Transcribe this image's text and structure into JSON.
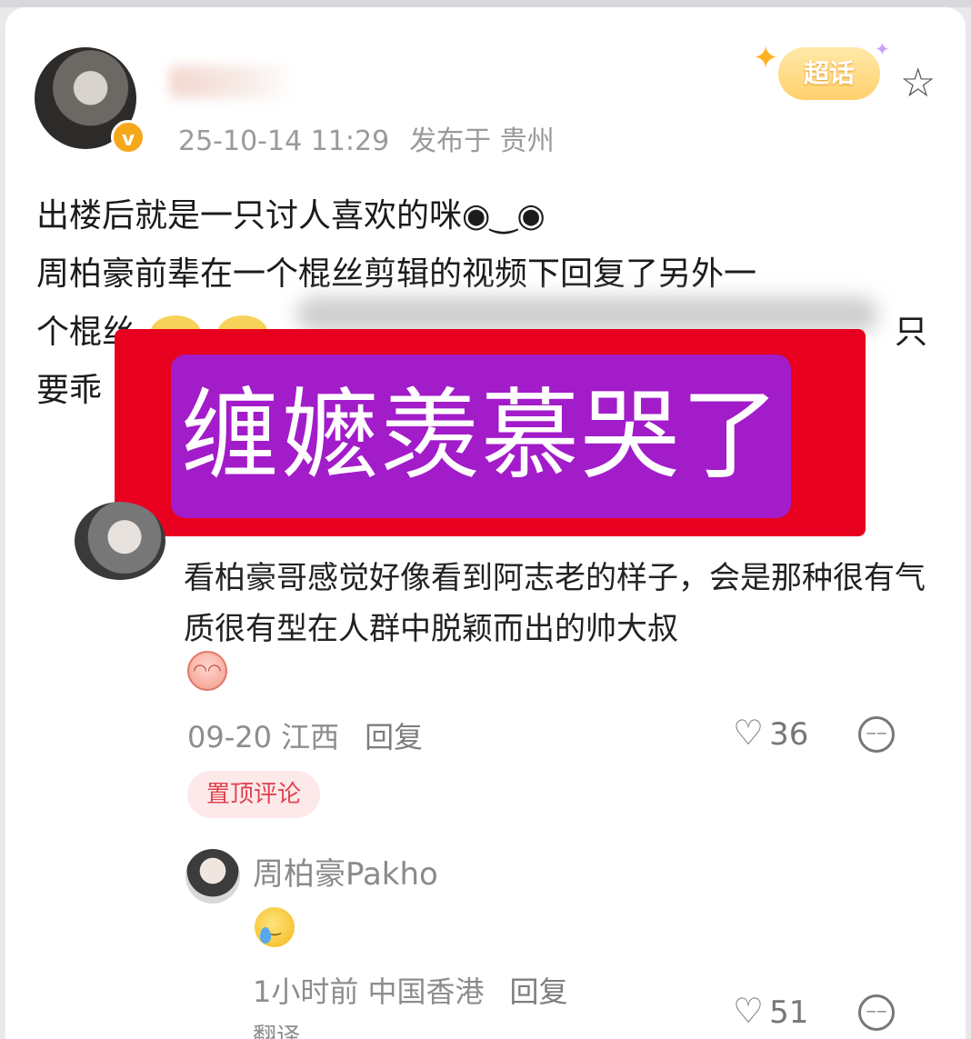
{
  "post": {
    "timestamp": "25-10-14 11:29",
    "location": "发布于 贵州",
    "badge_label": "超话",
    "lines": [
      "出楼后就是一只讨人喜欢的咪◉‿◉",
      "周柏豪前辈在一个棍丝剪辑的视频下回复了另外一",
      "个棍丝",
      "要乖"
    ],
    "line3_tail": "只"
  },
  "overlay": {
    "text": "缠嬷羡慕哭了"
  },
  "comment": {
    "text": "看柏豪哥感觉好像看到阿志老的样子，会是那种很有气质很有型在人群中脱颖而出的帅大叔",
    "date": "09-20 江西",
    "reply_label": "回复",
    "likes": "36",
    "pinned_label": "置顶评论"
  },
  "reply": {
    "author": "周柏豪Pakho",
    "time_location": "1小时前 中国香港",
    "reply_label": "回复",
    "likes": "51",
    "translate_label": "翻译"
  },
  "icons": {
    "star": "star-outline-icon",
    "heart": "heart-outline-icon",
    "more": "more-options-icon",
    "verified": "verified-v-badge-icon"
  },
  "colors": {
    "banner_red": "#e8001f",
    "banner_purple": "#a21cc9",
    "pinned_text": "#e0434f",
    "verified_badge": "#f6a71a"
  }
}
